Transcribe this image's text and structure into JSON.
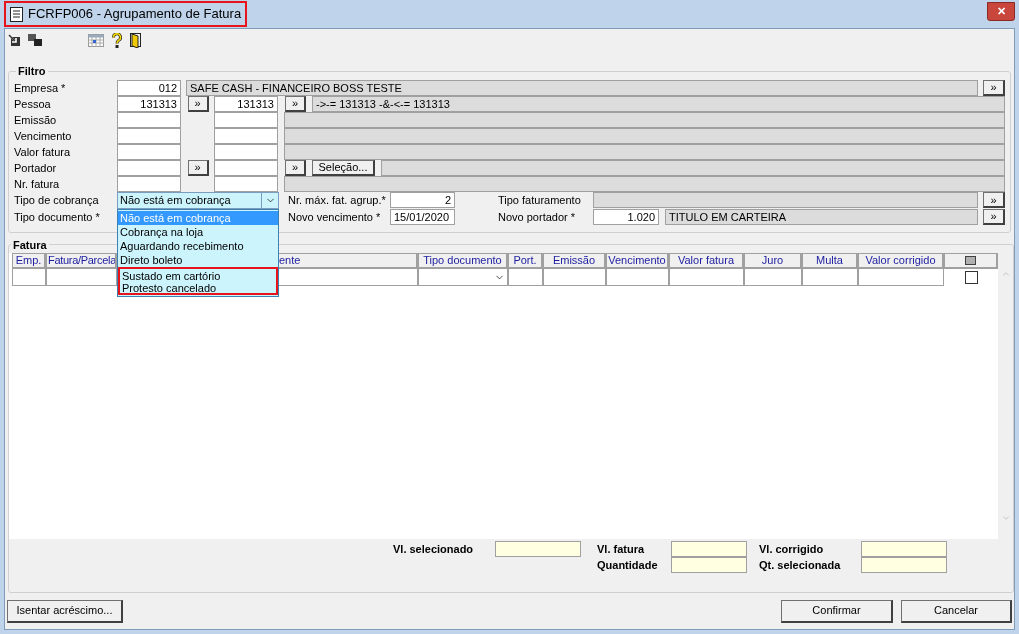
{
  "window": {
    "title": "FCRFP006 - Agrupamento de Fatura",
    "highlighted": true,
    "close": "✕"
  },
  "filter": {
    "title": "Filtro",
    "rows": [
      {
        "kind": "lookup",
        "label": "Empresa *",
        "code": "012",
        "description": "SAFE CASH - FINANCEIRO BOSS TESTE",
        "button": "»"
      },
      {
        "kind": "range",
        "label": "Pessoa",
        "from": "131313",
        "from_button": "»",
        "to": "131313",
        "to_button": "»",
        "description": "->-= 131313 -&-<-= 131313"
      },
      {
        "kind": "range",
        "label": "Emissão"
      },
      {
        "kind": "range",
        "label": "Vencimento"
      },
      {
        "kind": "range",
        "label": "Valor fatura"
      },
      {
        "kind": "range",
        "label": "Portador",
        "from_button": "»",
        "to_button": "»",
        "action": "Seleção..."
      },
      {
        "kind": "range",
        "label": "Nr. fatura"
      }
    ],
    "tipo_cobranca": {
      "label": "Tipo de cobrança",
      "value": "Não está em cobrança",
      "expanded": true,
      "options": [
        {
          "label": "Não está em cobrança",
          "selected": true,
          "highlighted": false
        },
        {
          "label": "Cobrança na loja",
          "selected": false,
          "highlighted": false
        },
        {
          "label": "Aguardando recebimento",
          "selected": false,
          "highlighted": false
        },
        {
          "label": "Direto boleto",
          "selected": false,
          "highlighted": false
        },
        {
          "label": "Sustado em cartório",
          "selected": false,
          "highlighted": true
        },
        {
          "label": "Protesto cancelado",
          "selected": false,
          "highlighted": true
        }
      ]
    },
    "nr_max": {
      "label": "Nr. máx. fat. agrup.*",
      "value": "2"
    },
    "tipo_faturamento": {
      "label": "Tipo faturamento",
      "button": "»"
    },
    "tipo_documento": {
      "label": "Tipo documento *"
    },
    "novo_vencimento": {
      "label": "Novo vencimento *",
      "value": "15/01/2020"
    },
    "novo_portador": {
      "label": "Novo portador *",
      "code": "1.020",
      "description": "TITULO EM CARTEIRA",
      "button": "»"
    }
  },
  "fatura": {
    "title": "Fatura",
    "columns": [
      {
        "label": "Emp."
      },
      {
        "label": "Fatura/Parcela"
      },
      {
        "label": "ente"
      },
      {
        "label": "Tipo documento"
      },
      {
        "label": "Port."
      },
      {
        "label": "Emissão"
      },
      {
        "label": "Vencimento"
      },
      {
        "label": "Valor fatura"
      },
      {
        "label": "Juro"
      },
      {
        "label": "Multa"
      },
      {
        "label": "Valor corrigido"
      }
    ],
    "rows": [
      {
        "checked": false
      }
    ],
    "totals": {
      "vl_selecionado": "Vl. selecionado",
      "vl_fatura": "Vl. fatura",
      "vl_corrigido": "Vl. corrigido",
      "quantidade": "Quantidade",
      "qt_selecionada": "Qt. selecionada"
    }
  },
  "buttons": {
    "left": "Isentar acréscimo...",
    "confirm": "Confirmar",
    "cancel": "Cancelar"
  }
}
